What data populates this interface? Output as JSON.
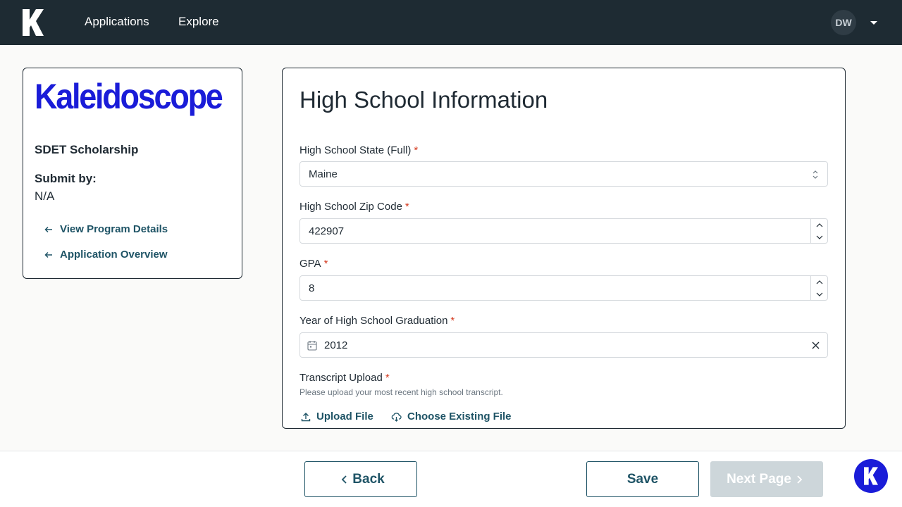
{
  "topbar": {
    "logo_icon": "k-logo-icon",
    "nav": [
      {
        "label": "Applications"
      },
      {
        "label": "Explore"
      }
    ],
    "avatar_initials": "DW",
    "avatar_menu_icon": "caret-down-icon"
  },
  "sidebar": {
    "brand_name": "Kaleidoscope",
    "program_name": "SDET Scholarship",
    "submit_by_label": "Submit by:",
    "submit_by_value": "N/A",
    "links": [
      {
        "label": "View Program Details",
        "icon": "arrow-left-icon"
      },
      {
        "label": "Application Overview",
        "icon": "arrow-left-icon"
      }
    ]
  },
  "form": {
    "title": "High School Information",
    "fields": {
      "state": {
        "label": "High School State (Full)",
        "required_mark": "*",
        "value": "Maine"
      },
      "zip": {
        "label": "High School Zip Code",
        "required_mark": "*",
        "value": "422907"
      },
      "gpa": {
        "label": "GPA",
        "required_mark": "*",
        "value": "8"
      },
      "grad_year": {
        "label": "Year of High School Graduation",
        "required_mark": "*",
        "value": "2012"
      },
      "transcript": {
        "label": "Transcript Upload",
        "required_mark": "*",
        "helper": "Please upload your most recent high school transcript."
      }
    },
    "upload_file_label": "Upload File",
    "choose_existing_label": "Choose Existing File"
  },
  "footer": {
    "back_label": "Back",
    "save_label": "Save",
    "next_label": "Next Page"
  },
  "colors": {
    "topbar": "#1e2b33",
    "brand": "#1a1cd8",
    "link": "#1f5466",
    "required": "#d43a1f"
  }
}
